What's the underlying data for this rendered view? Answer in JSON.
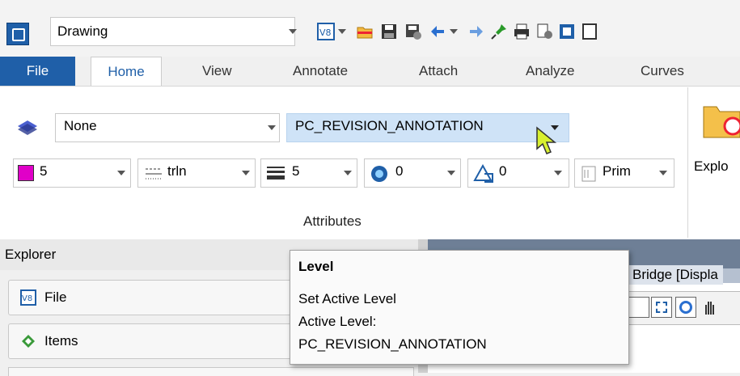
{
  "workspace": {
    "value": "Drawing"
  },
  "tabs": [
    {
      "label": "File"
    },
    {
      "label": "Home"
    },
    {
      "label": "View"
    },
    {
      "label": "Annotate"
    },
    {
      "label": "Attach"
    },
    {
      "label": "Analyze"
    },
    {
      "label": "Curves"
    }
  ],
  "attributes": {
    "level_display_value": "None",
    "active_level_value": "PC_REVISION_ANNOTATION",
    "color_value": "5",
    "linestyle_value": "trln",
    "weight_value": "5",
    "transparency_value": "0",
    "priority_value": "0",
    "class_value": "Prim",
    "group_label": "Attributes"
  },
  "explorer_button_label": "Explo",
  "explorer": {
    "title": "Explorer",
    "items": [
      {
        "label": "File"
      },
      {
        "label": "Items"
      }
    ]
  },
  "view": {
    "title": "Bridge [Displa"
  },
  "tooltip": {
    "title": "Level",
    "line1": "Set Active Level",
    "line2": "Active Level:",
    "line3": "PC_REVISION_ANNOTATION"
  },
  "colors": {
    "accent": "#1f5fa8",
    "highlight": "#cfe3f7",
    "color_swatch": "#e000c8"
  }
}
